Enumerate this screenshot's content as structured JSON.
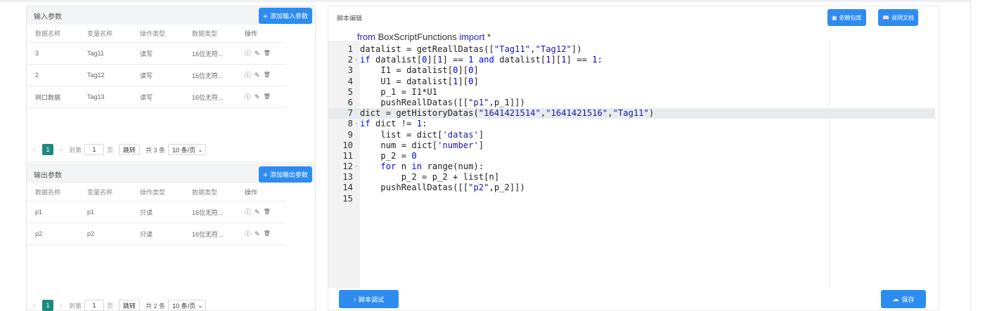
{
  "input_panel": {
    "title": "输入参数",
    "add_button": "添加输入参数",
    "columns": [
      "数据名称",
      "变量名称",
      "操作类型",
      "数据类型",
      "操作"
    ],
    "rows": [
      {
        "data_name": "3",
        "var_name": "Tag11",
        "op_type": "读写",
        "data_type": "16位无符..."
      },
      {
        "data_name": "2",
        "var_name": "Tag12",
        "op_type": "读写",
        "data_type": "16位无符..."
      },
      {
        "data_name": "网口数据",
        "var_name": "Tag13",
        "op_type": "读写",
        "data_type": "16位无符..."
      }
    ],
    "pager": {
      "current": "1",
      "goto_label": "到第",
      "goto_value": "1",
      "page_unit": "页",
      "go_button": "跳转",
      "total": "共 3 条",
      "page_size": "10 条/页"
    }
  },
  "output_panel": {
    "title": "输出参数",
    "add_button": "添加输出参数",
    "columns": [
      "数据名称",
      "变量名称",
      "操作类型",
      "数据类型",
      "操作"
    ],
    "rows": [
      {
        "data_name": "p1",
        "var_name": "p1",
        "op_type": "只读",
        "data_type": "16位无符..."
      },
      {
        "data_name": "p2",
        "var_name": "p2",
        "op_type": "只读",
        "data_type": "16位无符..."
      }
    ],
    "pager": {
      "current": "1",
      "goto_label": "到第",
      "goto_value": "1",
      "page_unit": "页",
      "go_button": "跳转",
      "total": "共 2 条",
      "page_size": "10 条/页"
    }
  },
  "editor": {
    "title": "脚本编辑",
    "deps_button": "依赖包库",
    "docs_button": "说明文档",
    "import_line": {
      "from": "from",
      "module": " BoxScriptFunctions ",
      "import": "import",
      "rest": " *"
    },
    "lines": [
      {
        "n": "1",
        "fold": "",
        "text": "datalist = getReallDatas([\"Tag11\",\"Tag12\"])"
      },
      {
        "n": "2",
        "fold": "-",
        "text": "if datalist[0][1] == 1 and datalist[1][1] == 1:"
      },
      {
        "n": "3",
        "fold": "",
        "text": "    I1 = datalist[0][0]"
      },
      {
        "n": "4",
        "fold": "",
        "text": "    U1 = datalist[1][0]"
      },
      {
        "n": "5",
        "fold": "",
        "text": "    p_1 = I1*U1"
      },
      {
        "n": "6",
        "fold": "",
        "text": "    pushReallDatas([[\"p1\",p_1]])"
      },
      {
        "n": "7",
        "fold": "",
        "text": "dict = getHistoryDatas(\"1641421514\",\"1641421516\",\"Tag11\")"
      },
      {
        "n": "8",
        "fold": "-",
        "text": "if dict != 1:"
      },
      {
        "n": "9",
        "fold": "",
        "text": "    list = dict['datas']"
      },
      {
        "n": "10",
        "fold": "",
        "text": "    num = dict['number']"
      },
      {
        "n": "11",
        "fold": "",
        "text": "    p_2 = 0"
      },
      {
        "n": "12",
        "fold": "-",
        "text": "    for n in range(num):"
      },
      {
        "n": "13",
        "fold": "",
        "text": "        p_2 = p_2 + list[n]"
      },
      {
        "n": "14",
        "fold": "",
        "text": "    pushReallDatas([[\"p2\",p_2]])"
      },
      {
        "n": "15",
        "fold": "",
        "text": ""
      }
    ],
    "active_line": 7,
    "debug_button": "脚本调试",
    "save_button": "保存"
  }
}
